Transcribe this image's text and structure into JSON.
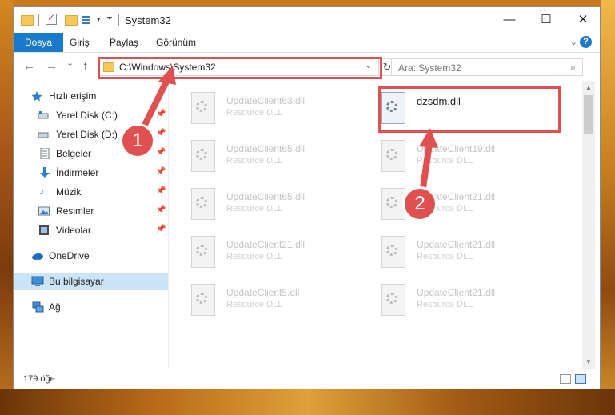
{
  "window": {
    "title": "System32",
    "controls": {
      "minimize": "—",
      "maximize": "☐",
      "close": "✕"
    }
  },
  "ribbon": {
    "tabs": [
      "Dosya",
      "Giriş",
      "Paylaş",
      "Görünüm"
    ],
    "help": "?"
  },
  "navigation": {
    "back": "←",
    "forward": "→",
    "recent": "⌄",
    "up": "↑",
    "address": "C:\\Windows\\System32",
    "refresh": "↻",
    "search_placeholder": "Ara: System32"
  },
  "sidebar": {
    "items": [
      {
        "label": "Hızlı erişim",
        "icon": "star-icon",
        "pinned": false
      },
      {
        "label": "Yerel Disk (C:)",
        "icon": "drive-icon",
        "pinned": true
      },
      {
        "label": "Yerel Disk (D:)",
        "icon": "drive-icon",
        "pinned": true
      },
      {
        "label": "Belgeler",
        "icon": "document-icon",
        "pinned": true
      },
      {
        "label": "İndirmeler",
        "icon": "download-icon",
        "pinned": true
      },
      {
        "label": "Müzik",
        "icon": "music-icon",
        "pinned": true
      },
      {
        "label": "Resimler",
        "icon": "picture-icon",
        "pinned": true
      },
      {
        "label": "Videolar",
        "icon": "video-icon",
        "pinned": true
      },
      {
        "label": "OneDrive",
        "icon": "cloud-icon",
        "pinned": false
      },
      {
        "label": "Bu bilgisayar",
        "icon": "computer-icon",
        "pinned": false,
        "selected": true
      },
      {
        "label": "Ağ",
        "icon": "network-icon",
        "pinned": false
      }
    ]
  },
  "files": [
    {
      "name": "UpdateClient63.dll",
      "desc": "Resource DLL"
    },
    {
      "name": "dzsdm.dll",
      "desc": ""
    },
    {
      "name": "UpdateClient65.dll",
      "desc": "Resource DLL"
    },
    {
      "name": "UpdateClient19.dll",
      "desc": "Resource DLL"
    },
    {
      "name": "UpdateClient65.dll",
      "desc": "Resource DLL"
    },
    {
      "name": "UpdateClient21.dll",
      "desc": "Resource DLL"
    },
    {
      "name": "UpdateClient21.dll",
      "desc": "Resource DLL"
    },
    {
      "name": "UpdateClient21.dll",
      "desc": "Resource DLL"
    },
    {
      "name": "UpdateClient5.dll",
      "desc": "Resource DLL"
    },
    {
      "name": "UpdateClient21.dll",
      "desc": "Resource DLL"
    }
  ],
  "status": {
    "count": "179 öğe"
  },
  "markers": {
    "one": "1",
    "two": "2"
  },
  "colors": {
    "accent": "#1979ca",
    "highlight": "#e05050",
    "selection": "#cce4f7"
  }
}
